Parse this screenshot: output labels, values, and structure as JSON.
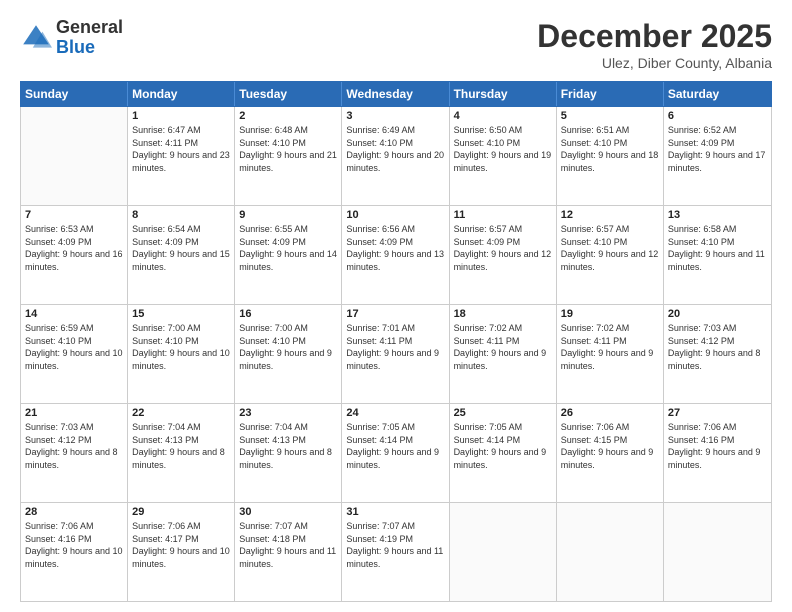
{
  "logo": {
    "general": "General",
    "blue": "Blue"
  },
  "header": {
    "month": "December 2025",
    "location": "Ulez, Diber County, Albania"
  },
  "weekdays": [
    "Sunday",
    "Monday",
    "Tuesday",
    "Wednesday",
    "Thursday",
    "Friday",
    "Saturday"
  ],
  "weeks": [
    [
      {
        "day": "",
        "empty": true
      },
      {
        "day": "1",
        "sunrise": "Sunrise: 6:47 AM",
        "sunset": "Sunset: 4:11 PM",
        "daylight": "Daylight: 9 hours and 23 minutes."
      },
      {
        "day": "2",
        "sunrise": "Sunrise: 6:48 AM",
        "sunset": "Sunset: 4:10 PM",
        "daylight": "Daylight: 9 hours and 21 minutes."
      },
      {
        "day": "3",
        "sunrise": "Sunrise: 6:49 AM",
        "sunset": "Sunset: 4:10 PM",
        "daylight": "Daylight: 9 hours and 20 minutes."
      },
      {
        "day": "4",
        "sunrise": "Sunrise: 6:50 AM",
        "sunset": "Sunset: 4:10 PM",
        "daylight": "Daylight: 9 hours and 19 minutes."
      },
      {
        "day": "5",
        "sunrise": "Sunrise: 6:51 AM",
        "sunset": "Sunset: 4:10 PM",
        "daylight": "Daylight: 9 hours and 18 minutes."
      },
      {
        "day": "6",
        "sunrise": "Sunrise: 6:52 AM",
        "sunset": "Sunset: 4:09 PM",
        "daylight": "Daylight: 9 hours and 17 minutes."
      }
    ],
    [
      {
        "day": "7",
        "sunrise": "Sunrise: 6:53 AM",
        "sunset": "Sunset: 4:09 PM",
        "daylight": "Daylight: 9 hours and 16 minutes."
      },
      {
        "day": "8",
        "sunrise": "Sunrise: 6:54 AM",
        "sunset": "Sunset: 4:09 PM",
        "daylight": "Daylight: 9 hours and 15 minutes."
      },
      {
        "day": "9",
        "sunrise": "Sunrise: 6:55 AM",
        "sunset": "Sunset: 4:09 PM",
        "daylight": "Daylight: 9 hours and 14 minutes."
      },
      {
        "day": "10",
        "sunrise": "Sunrise: 6:56 AM",
        "sunset": "Sunset: 4:09 PM",
        "daylight": "Daylight: 9 hours and 13 minutes."
      },
      {
        "day": "11",
        "sunrise": "Sunrise: 6:57 AM",
        "sunset": "Sunset: 4:09 PM",
        "daylight": "Daylight: 9 hours and 12 minutes."
      },
      {
        "day": "12",
        "sunrise": "Sunrise: 6:57 AM",
        "sunset": "Sunset: 4:10 PM",
        "daylight": "Daylight: 9 hours and 12 minutes."
      },
      {
        "day": "13",
        "sunrise": "Sunrise: 6:58 AM",
        "sunset": "Sunset: 4:10 PM",
        "daylight": "Daylight: 9 hours and 11 minutes."
      }
    ],
    [
      {
        "day": "14",
        "sunrise": "Sunrise: 6:59 AM",
        "sunset": "Sunset: 4:10 PM",
        "daylight": "Daylight: 9 hours and 10 minutes."
      },
      {
        "day": "15",
        "sunrise": "Sunrise: 7:00 AM",
        "sunset": "Sunset: 4:10 PM",
        "daylight": "Daylight: 9 hours and 10 minutes."
      },
      {
        "day": "16",
        "sunrise": "Sunrise: 7:00 AM",
        "sunset": "Sunset: 4:10 PM",
        "daylight": "Daylight: 9 hours and 9 minutes."
      },
      {
        "day": "17",
        "sunrise": "Sunrise: 7:01 AM",
        "sunset": "Sunset: 4:11 PM",
        "daylight": "Daylight: 9 hours and 9 minutes."
      },
      {
        "day": "18",
        "sunrise": "Sunrise: 7:02 AM",
        "sunset": "Sunset: 4:11 PM",
        "daylight": "Daylight: 9 hours and 9 minutes."
      },
      {
        "day": "19",
        "sunrise": "Sunrise: 7:02 AM",
        "sunset": "Sunset: 4:11 PM",
        "daylight": "Daylight: 9 hours and 9 minutes."
      },
      {
        "day": "20",
        "sunrise": "Sunrise: 7:03 AM",
        "sunset": "Sunset: 4:12 PM",
        "daylight": "Daylight: 9 hours and 8 minutes."
      }
    ],
    [
      {
        "day": "21",
        "sunrise": "Sunrise: 7:03 AM",
        "sunset": "Sunset: 4:12 PM",
        "daylight": "Daylight: 9 hours and 8 minutes."
      },
      {
        "day": "22",
        "sunrise": "Sunrise: 7:04 AM",
        "sunset": "Sunset: 4:13 PM",
        "daylight": "Daylight: 9 hours and 8 minutes."
      },
      {
        "day": "23",
        "sunrise": "Sunrise: 7:04 AM",
        "sunset": "Sunset: 4:13 PM",
        "daylight": "Daylight: 9 hours and 8 minutes."
      },
      {
        "day": "24",
        "sunrise": "Sunrise: 7:05 AM",
        "sunset": "Sunset: 4:14 PM",
        "daylight": "Daylight: 9 hours and 9 minutes."
      },
      {
        "day": "25",
        "sunrise": "Sunrise: 7:05 AM",
        "sunset": "Sunset: 4:14 PM",
        "daylight": "Daylight: 9 hours and 9 minutes."
      },
      {
        "day": "26",
        "sunrise": "Sunrise: 7:06 AM",
        "sunset": "Sunset: 4:15 PM",
        "daylight": "Daylight: 9 hours and 9 minutes."
      },
      {
        "day": "27",
        "sunrise": "Sunrise: 7:06 AM",
        "sunset": "Sunset: 4:16 PM",
        "daylight": "Daylight: 9 hours and 9 minutes."
      }
    ],
    [
      {
        "day": "28",
        "sunrise": "Sunrise: 7:06 AM",
        "sunset": "Sunset: 4:16 PM",
        "daylight": "Daylight: 9 hours and 10 minutes."
      },
      {
        "day": "29",
        "sunrise": "Sunrise: 7:06 AM",
        "sunset": "Sunset: 4:17 PM",
        "daylight": "Daylight: 9 hours and 10 minutes."
      },
      {
        "day": "30",
        "sunrise": "Sunrise: 7:07 AM",
        "sunset": "Sunset: 4:18 PM",
        "daylight": "Daylight: 9 hours and 11 minutes."
      },
      {
        "day": "31",
        "sunrise": "Sunrise: 7:07 AM",
        "sunset": "Sunset: 4:19 PM",
        "daylight": "Daylight: 9 hours and 11 minutes."
      },
      {
        "day": "",
        "empty": true
      },
      {
        "day": "",
        "empty": true
      },
      {
        "day": "",
        "empty": true
      }
    ]
  ]
}
